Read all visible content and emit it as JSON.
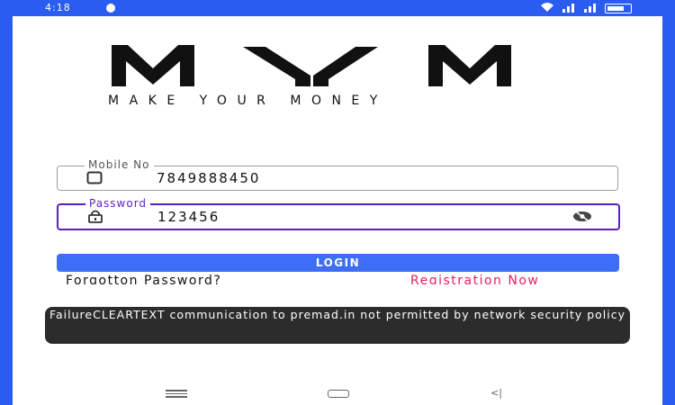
{
  "status_bar": {
    "time": "4:18"
  },
  "brand": {
    "tagline": "MAKE YOUR MONEY"
  },
  "mobile_field": {
    "label": "Mobile No",
    "value": "7849888450"
  },
  "password_field": {
    "label": "Password",
    "value": "123456"
  },
  "login_button": {
    "label": "LOGIN"
  },
  "links": {
    "forgot": "Forgotton Password?",
    "register": "Registration Now"
  },
  "toast": {
    "message": "FailureCLEARTEXT communication to premad.in not permitted by network security policy"
  },
  "colors": {
    "status_bar": "#2a5cf0",
    "login": "#3d6ef5",
    "focus": "#5a1fc8",
    "register_link": "#e91e63"
  },
  "icons": [
    "signal-icon",
    "wifi-icon",
    "battery-icon",
    "phone-icon",
    "lock-icon",
    "eye-off-icon",
    "recents-icon",
    "home-icon",
    "back-icon"
  ]
}
